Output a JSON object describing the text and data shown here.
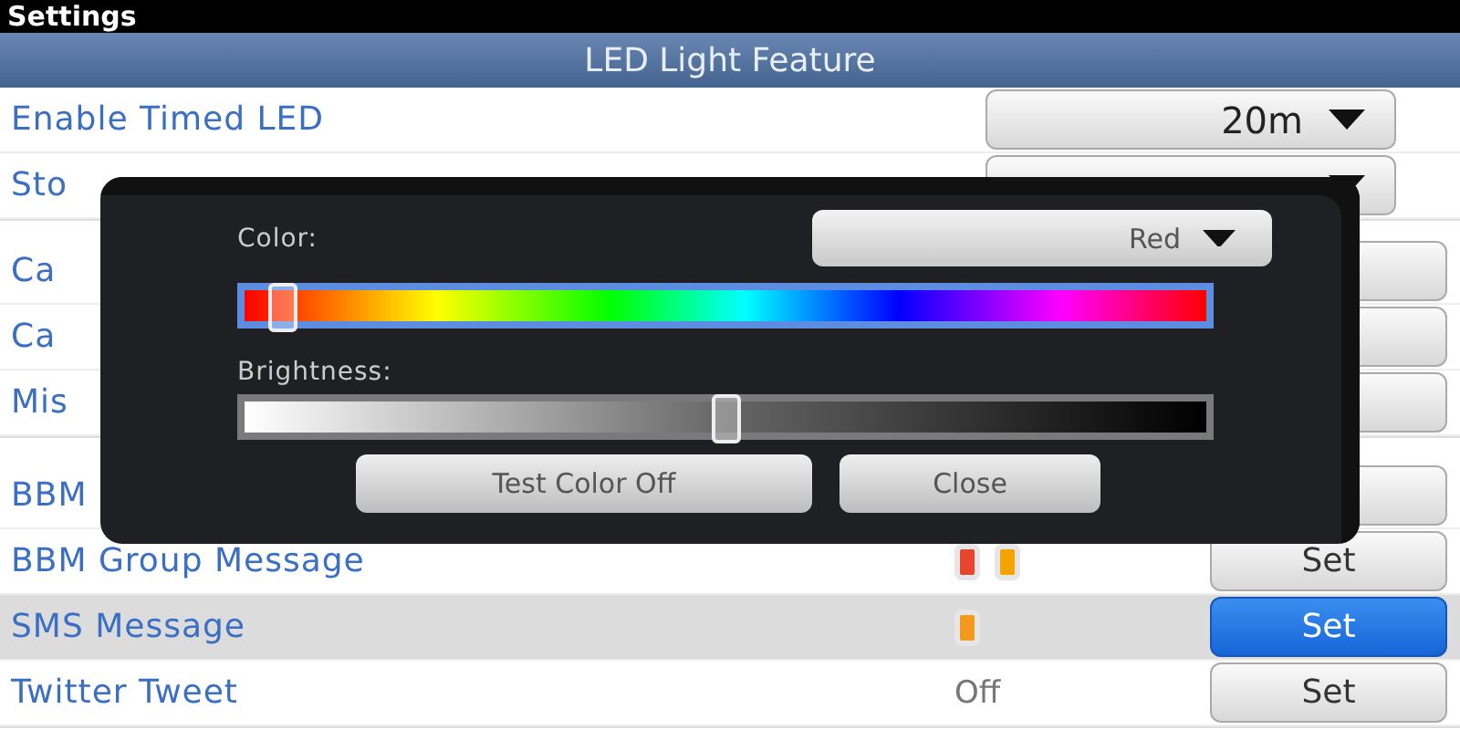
{
  "status_bar": {
    "title": "Settings"
  },
  "header": {
    "title": "LED Light Feature"
  },
  "sections": [
    {
      "rows": [
        {
          "label": "Enable Timed LED",
          "kind": "dropdown",
          "value": "20m"
        },
        {
          "label": "Sto",
          "kind": "dropdown"
        }
      ]
    },
    {
      "rows": [
        {
          "label": "Ca",
          "kind": "button",
          "selected": false
        },
        {
          "label": "Ca",
          "kind": "button",
          "selected": false
        },
        {
          "label": "Mis",
          "kind": "button",
          "selected": false
        }
      ]
    },
    {
      "rows": [
        {
          "label": "BBM",
          "kind": "button",
          "selected": false
        },
        {
          "label": "BBM Group Message",
          "kind": "button",
          "button": "Set",
          "selected": false,
          "indicators": [
            {
              "color": "#e8452f"
            },
            {
              "color": "#f5a300"
            }
          ]
        },
        {
          "label": "SMS Message",
          "kind": "button",
          "button": "Set",
          "selected": true,
          "indicators": [
            {
              "color": "#f39a1c"
            }
          ]
        },
        {
          "label": "Twitter Tweet",
          "kind": "button",
          "button": "Set",
          "selected": false,
          "status": "Off"
        }
      ]
    }
  ],
  "dialog": {
    "color_label": "Color:",
    "color_value": "Red",
    "hue": {
      "level": 0.04
    },
    "brightness_label": "Brightness:",
    "brightness": {
      "level": 0.5
    },
    "buttons": [
      "Test Color Off",
      "Close"
    ]
  }
}
